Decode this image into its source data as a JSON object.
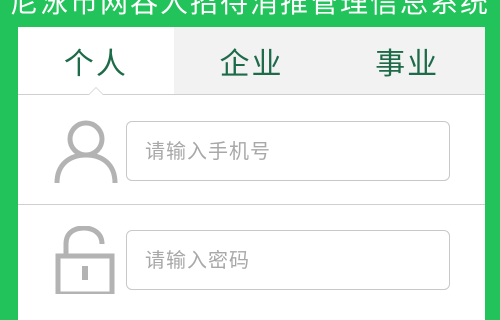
{
  "header": {
    "title": "尼泳市网吞人招待消推管理信总系统"
  },
  "tabs": [
    {
      "label": "个人",
      "active": true
    },
    {
      "label": "企业",
      "active": false
    },
    {
      "label": "事业",
      "active": false
    }
  ],
  "form": {
    "phone": {
      "icon": "user-icon",
      "value": "",
      "placeholder": "请输入手机号"
    },
    "password": {
      "icon": "lock-icon",
      "value": "",
      "placeholder": "请输入密码"
    }
  },
  "colors": {
    "background": "#22c35a",
    "tab_text": "#1e6b4a",
    "icon": "#b3b3b3",
    "placeholder": "#a8a8a8"
  }
}
